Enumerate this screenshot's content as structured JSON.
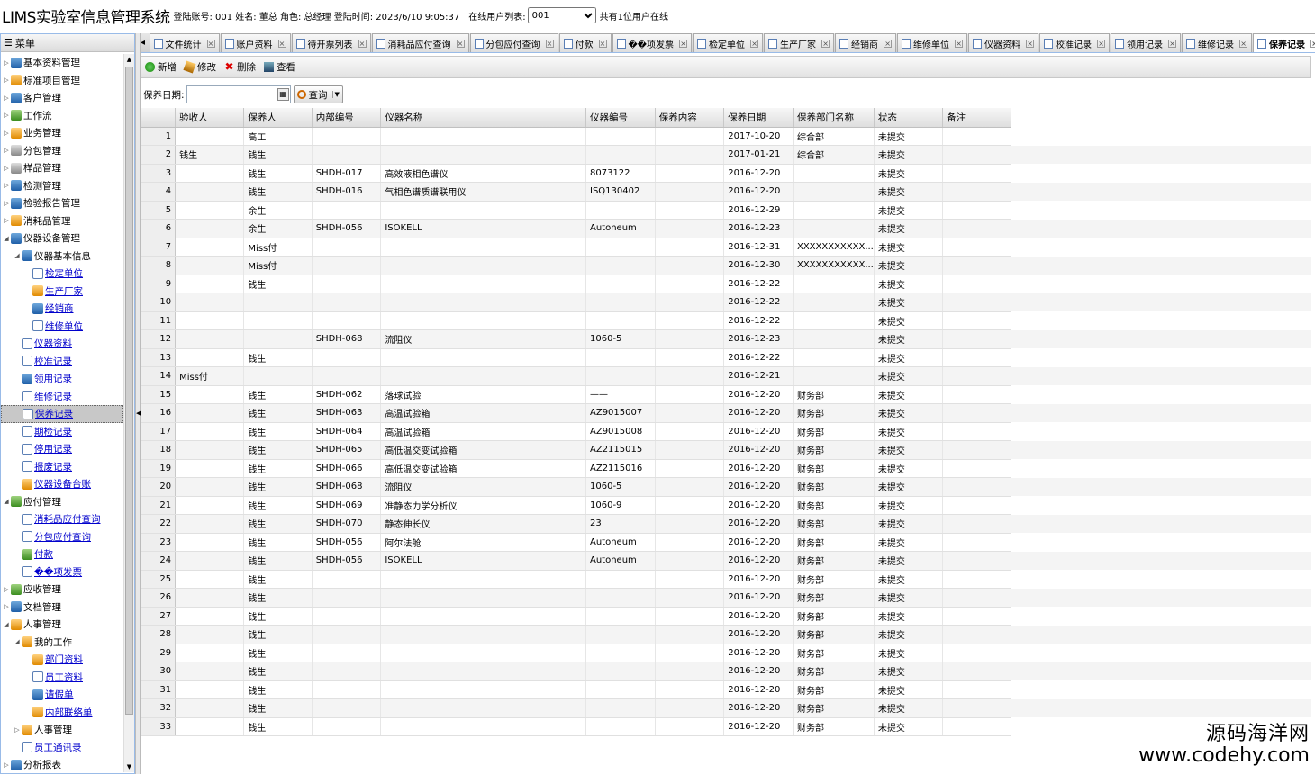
{
  "header": {
    "app_title": "LIMS实验室信息管理系统",
    "login_info": "登陆账号: 001 姓名: 董总 角色: 总经理 登陆时间: 2023/6/10 9:05:37",
    "online_list_label": "在线用户列表:",
    "online_selected": "001",
    "online_count": "共有1位用户在线"
  },
  "sidebar": {
    "title": "菜单",
    "items": [
      {
        "label": "基本资料管理",
        "level": 0,
        "arrow": "▷",
        "icon": "blue"
      },
      {
        "label": "标准项目管理",
        "level": 0,
        "arrow": "▷",
        "icon": "orange"
      },
      {
        "label": "客户管理",
        "level": 0,
        "arrow": "▷",
        "icon": "blue"
      },
      {
        "label": "工作流",
        "level": 0,
        "arrow": "▷",
        "icon": "green"
      },
      {
        "label": "业务管理",
        "level": 0,
        "arrow": "▷",
        "icon": "orange"
      },
      {
        "label": "分包管理",
        "level": 0,
        "arrow": "▷",
        "icon": "gray"
      },
      {
        "label": "样品管理",
        "level": 0,
        "arrow": "▷",
        "icon": "gray"
      },
      {
        "label": "检测管理",
        "level": 0,
        "arrow": "▷",
        "icon": "blue"
      },
      {
        "label": "检验报告管理",
        "level": 0,
        "arrow": "▷",
        "icon": "blue"
      },
      {
        "label": "消耗品管理",
        "level": 0,
        "arrow": "▷",
        "icon": "orange"
      },
      {
        "label": "仪器设备管理",
        "level": 0,
        "arrow": "◢",
        "icon": "blue"
      },
      {
        "label": "仪器基本信息",
        "level": 1,
        "arrow": "◢",
        "icon": "blue"
      },
      {
        "label": "检定单位",
        "level": 2,
        "arrow": "",
        "icon": "doc",
        "link": true
      },
      {
        "label": "生产厂家",
        "level": 2,
        "arrow": "",
        "icon": "orange",
        "link": true
      },
      {
        "label": "经销商",
        "level": 2,
        "arrow": "",
        "icon": "blue",
        "link": true
      },
      {
        "label": "维修单位",
        "level": 2,
        "arrow": "",
        "icon": "doc",
        "link": true
      },
      {
        "label": "仪器资料",
        "level": 1,
        "arrow": "",
        "icon": "doc",
        "link": true
      },
      {
        "label": "校准记录",
        "level": 1,
        "arrow": "",
        "icon": "doc",
        "link": true
      },
      {
        "label": "领用记录",
        "level": 1,
        "arrow": "",
        "icon": "blue",
        "link": true
      },
      {
        "label": "维修记录",
        "level": 1,
        "arrow": "",
        "icon": "doc",
        "link": true
      },
      {
        "label": "保养记录",
        "level": 1,
        "arrow": "",
        "icon": "doc",
        "link": true,
        "selected": true
      },
      {
        "label": "期检记录",
        "level": 1,
        "arrow": "",
        "icon": "doc",
        "link": true
      },
      {
        "label": "停用记录",
        "level": 1,
        "arrow": "",
        "icon": "doc",
        "link": true
      },
      {
        "label": "报废记录",
        "level": 1,
        "arrow": "",
        "icon": "doc",
        "link": true
      },
      {
        "label": "仪器设备台账",
        "level": 1,
        "arrow": "",
        "icon": "orange",
        "link": true
      },
      {
        "label": "应付管理",
        "level": 0,
        "arrow": "◢",
        "icon": "green"
      },
      {
        "label": "消耗品应付查询",
        "level": 1,
        "arrow": "",
        "icon": "doc",
        "link": true
      },
      {
        "label": "分包应付查询",
        "level": 1,
        "arrow": "",
        "icon": "doc",
        "link": true
      },
      {
        "label": "付款",
        "level": 1,
        "arrow": "",
        "icon": "green",
        "link": true
      },
      {
        "label": "��项发票",
        "level": 1,
        "arrow": "",
        "icon": "doc",
        "link": true
      },
      {
        "label": "应收管理",
        "level": 0,
        "arrow": "▷",
        "icon": "green"
      },
      {
        "label": "文档管理",
        "level": 0,
        "arrow": "▷",
        "icon": "blue"
      },
      {
        "label": "人事管理",
        "level": 0,
        "arrow": "◢",
        "icon": "orange"
      },
      {
        "label": "我的工作",
        "level": 1,
        "arrow": "◢",
        "icon": "orange"
      },
      {
        "label": "部门资料",
        "level": 2,
        "arrow": "",
        "icon": "orange",
        "link": true
      },
      {
        "label": "员工资料",
        "level": 2,
        "arrow": "",
        "icon": "doc",
        "link": true
      },
      {
        "label": "请假单",
        "level": 2,
        "arrow": "",
        "icon": "blue",
        "link": true
      },
      {
        "label": "内部联络单",
        "level": 2,
        "arrow": "",
        "icon": "orange",
        "link": true
      },
      {
        "label": "人事管理",
        "level": 1,
        "arrow": "▷",
        "icon": "orange"
      },
      {
        "label": "员工通讯录",
        "level": 1,
        "arrow": "",
        "icon": "doc",
        "link": true
      },
      {
        "label": "分析报表",
        "level": 0,
        "arrow": "▷",
        "icon": "blue"
      }
    ]
  },
  "tabs": [
    {
      "label": "文件统计"
    },
    {
      "label": "账户资料"
    },
    {
      "label": "待开票列表"
    },
    {
      "label": "消耗品应付查询"
    },
    {
      "label": "分包应付查询"
    },
    {
      "label": "付款"
    },
    {
      "label": "��项发票"
    },
    {
      "label": "检定单位"
    },
    {
      "label": "生产厂家"
    },
    {
      "label": "经销商"
    },
    {
      "label": "维修单位"
    },
    {
      "label": "仪器资料"
    },
    {
      "label": "校准记录"
    },
    {
      "label": "领用记录"
    },
    {
      "label": "维修记录"
    },
    {
      "label": "保养记录",
      "active": true
    }
  ],
  "toolbar": {
    "add": "新增",
    "edit": "修改",
    "delete": "删除",
    "view": "查看"
  },
  "search": {
    "date_label": "保养日期:",
    "query_label": "查询"
  },
  "grid": {
    "columns": [
      "验收人",
      "保养人",
      "内部编号",
      "仪器名称",
      "仪器编号",
      "保养内容",
      "保养日期",
      "保养部门名称",
      "状态",
      "备注"
    ],
    "rows": [
      [
        "1",
        "",
        "高工",
        "",
        "",
        "",
        "",
        "2017-10-20",
        "综合部",
        "未提交",
        ""
      ],
      [
        "2",
        "钱生",
        "钱生",
        "",
        "",
        "",
        "",
        "2017-01-21",
        "综合部",
        "未提交",
        ""
      ],
      [
        "3",
        "",
        "钱生",
        "SHDH-017",
        "高效液相色谱仪",
        "8073122",
        "",
        "2016-12-20",
        "",
        "未提交",
        ""
      ],
      [
        "4",
        "",
        "钱生",
        "SHDH-016",
        "气相色谱质谱联用仪",
        "ISQ130402",
        "",
        "2016-12-20",
        "",
        "未提交",
        ""
      ],
      [
        "5",
        "",
        "余生",
        "",
        "",
        "",
        "",
        "2016-12-29",
        "",
        "未提交",
        ""
      ],
      [
        "6",
        "",
        "余生",
        "SHDH-056",
        "ISOKELL",
        "Autoneum",
        "",
        "2016-12-23",
        "",
        "未提交",
        ""
      ],
      [
        "7",
        "",
        "Miss付",
        "",
        "",
        "",
        "",
        "2016-12-31",
        "XXXXXXXXXXX...",
        "未提交",
        ""
      ],
      [
        "8",
        "",
        "Miss付",
        "",
        "",
        "",
        "",
        "2016-12-30",
        "XXXXXXXXXXX...",
        "未提交",
        ""
      ],
      [
        "9",
        "",
        "钱生",
        "",
        "",
        "",
        "",
        "2016-12-22",
        "",
        "未提交",
        ""
      ],
      [
        "10",
        "",
        "",
        "",
        "",
        "",
        "",
        "2016-12-22",
        "",
        "未提交",
        ""
      ],
      [
        "11",
        "",
        "",
        "",
        "",
        "",
        "",
        "2016-12-22",
        "",
        "未提交",
        ""
      ],
      [
        "12",
        "",
        "",
        "SHDH-068",
        "流阻仪",
        "1060-5",
        "",
        "2016-12-23",
        "",
        "未提交",
        ""
      ],
      [
        "13",
        "",
        "钱生",
        "",
        "",
        "",
        "",
        "2016-12-22",
        "",
        "未提交",
        ""
      ],
      [
        "14",
        "Miss付",
        "",
        "",
        "",
        "",
        "",
        "2016-12-21",
        "",
        "未提交",
        ""
      ],
      [
        "15",
        "",
        "钱生",
        "SHDH-062",
        "落球试验",
        "——",
        "",
        "2016-12-20",
        "财务部",
        "未提交",
        ""
      ],
      [
        "16",
        "",
        "钱生",
        "SHDH-063",
        "高温试验箱",
        "AZ9015007",
        "",
        "2016-12-20",
        "财务部",
        "未提交",
        ""
      ],
      [
        "17",
        "",
        "钱生",
        "SHDH-064",
        "高温试验箱",
        "AZ9015008",
        "",
        "2016-12-20",
        "财务部",
        "未提交",
        ""
      ],
      [
        "18",
        "",
        "钱生",
        "SHDH-065",
        "高低温交变试验箱",
        "AZ2115015",
        "",
        "2016-12-20",
        "财务部",
        "未提交",
        ""
      ],
      [
        "19",
        "",
        "钱生",
        "SHDH-066",
        "高低温交变试验箱",
        "AZ2115016",
        "",
        "2016-12-20",
        "财务部",
        "未提交",
        ""
      ],
      [
        "20",
        "",
        "钱生",
        "SHDH-068",
        "流阻仪",
        "1060-5",
        "",
        "2016-12-20",
        "财务部",
        "未提交",
        ""
      ],
      [
        "21",
        "",
        "钱生",
        "SHDH-069",
        "准静态力学分析仪",
        "1060-9",
        "",
        "2016-12-20",
        "财务部",
        "未提交",
        ""
      ],
      [
        "22",
        "",
        "钱生",
        "SHDH-070",
        "静态伸长仪",
        "23",
        "",
        "2016-12-20",
        "财务部",
        "未提交",
        ""
      ],
      [
        "23",
        "",
        "钱生",
        "SHDH-056",
        "阿尔法舱",
        "Autoneum",
        "",
        "2016-12-20",
        "财务部",
        "未提交",
        ""
      ],
      [
        "24",
        "",
        "钱生",
        "SHDH-056",
        "ISOKELL",
        "Autoneum",
        "",
        "2016-12-20",
        "财务部",
        "未提交",
        ""
      ],
      [
        "25",
        "",
        "钱生",
        "",
        "",
        "",
        "",
        "2016-12-20",
        "财务部",
        "未提交",
        ""
      ],
      [
        "26",
        "",
        "钱生",
        "",
        "",
        "",
        "",
        "2016-12-20",
        "财务部",
        "未提交",
        ""
      ],
      [
        "27",
        "",
        "钱生",
        "",
        "",
        "",
        "",
        "2016-12-20",
        "财务部",
        "未提交",
        ""
      ],
      [
        "28",
        "",
        "钱生",
        "",
        "",
        "",
        "",
        "2016-12-20",
        "财务部",
        "未提交",
        ""
      ],
      [
        "29",
        "",
        "钱生",
        "",
        "",
        "",
        "",
        "2016-12-20",
        "财务部",
        "未提交",
        ""
      ],
      [
        "30",
        "",
        "钱生",
        "",
        "",
        "",
        "",
        "2016-12-20",
        "财务部",
        "未提交",
        ""
      ],
      [
        "31",
        "",
        "钱生",
        "",
        "",
        "",
        "",
        "2016-12-20",
        "财务部",
        "未提交",
        ""
      ],
      [
        "32",
        "",
        "钱生",
        "",
        "",
        "",
        "",
        "2016-12-20",
        "财务部",
        "未提交",
        ""
      ],
      [
        "33",
        "",
        "钱生",
        "",
        "",
        "",
        "",
        "2016-12-20",
        "财务部",
        "未提交",
        ""
      ]
    ]
  },
  "watermark": {
    "line1": "源码海洋网",
    "line2": "www.codehy.com"
  }
}
